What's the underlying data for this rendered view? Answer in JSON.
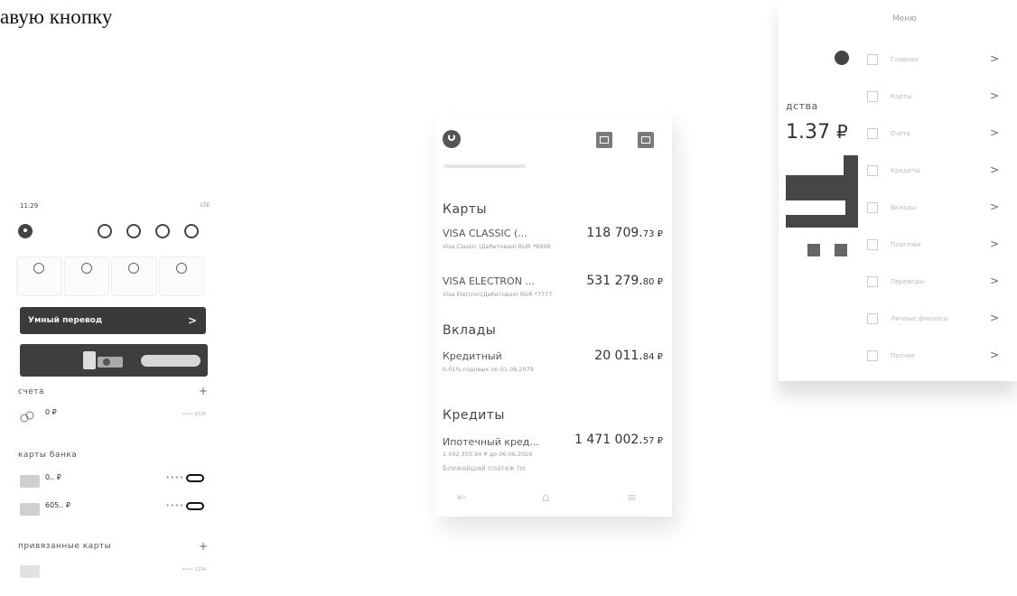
{
  "heading_fragment": "авую кнопку",
  "phone1": {
    "time": "11:29",
    "signal": "LTE",
    "quick_tiles": [
      {
        "icon": "transfer-icon",
        "label": ""
      },
      {
        "icon": "card-icon",
        "label": ""
      },
      {
        "icon": "phone-icon",
        "label": ""
      },
      {
        "icon": "smile-icon",
        "label": ""
      }
    ],
    "smart_transfer": "Умный перевод",
    "chevron": ">",
    "banner_text": "",
    "accounts": {
      "title": "счета",
      "plus": "+",
      "rows": [
        {
          "amount": "0 ₽",
          "sub": "",
          "number": "•••• 4315"
        }
      ]
    },
    "bank_cards": {
      "title": "карты банка",
      "rows": [
        {
          "amount": "0.. ₽",
          "sub": "",
          "dots": "••••"
        },
        {
          "amount": "605.. ₽",
          "sub": "",
          "dots": "••••"
        }
      ]
    },
    "linked_cards": {
      "title": "привязанные карты",
      "plus": "+",
      "rows": [
        {
          "amount": "",
          "sub": "",
          "number": "•••• 1154"
        }
      ]
    }
  },
  "phone2": {
    "cards": {
      "title": "Карты",
      "items": [
        {
          "name": "VISA CLASSIC (...",
          "amount_main": "118 709.",
          "amount_cents": "73 ₽",
          "detail1": "Visa Classic (Дебетовая) RUR *9999",
          "detail2": ""
        },
        {
          "name": "VISA ELECTRON ...",
          "amount_main": "531 279.",
          "amount_cents": "80 ₽",
          "detail1": "Visa Electron(Дебетовая) RUR *7777",
          "detail2": ""
        }
      ]
    },
    "deposits": {
      "title": "Вклады",
      "items": [
        {
          "name": "Кредитный",
          "amount_main": "20 011.",
          "amount_cents": "84 ₽",
          "detail1": "0.01% годовых по 01.06.2079",
          "detail2": ""
        }
      ]
    },
    "credits": {
      "title": "Кредиты",
      "items": [
        {
          "name": "Ипотечный кред...",
          "amount_main": "1 471 002.",
          "amount_cents": "57 ₽",
          "detail1": "1 042 355.94 ₽ до 06.06.2026",
          "detail2": "Ближайший платеж по"
        }
      ]
    },
    "nav": [
      "⇤",
      "⌂",
      "≡"
    ]
  },
  "phone3": {
    "menu_title": "Меню",
    "funds_label": "дства",
    "balance_main": "1.37",
    "balance_currency": "₽",
    "menu_items": [
      {
        "icon": "home-icon",
        "label": "Главная"
      },
      {
        "icon": "card-icon",
        "label": "Карты"
      },
      {
        "icon": "account-icon",
        "label": "Счета"
      },
      {
        "icon": "credit-icon",
        "label": "Кредиты"
      },
      {
        "icon": "deposit-icon",
        "label": "Вклады"
      },
      {
        "icon": "payment-icon",
        "label": "Платежи"
      },
      {
        "icon": "transfer-icon",
        "label": "Переводы"
      },
      {
        "icon": "template-icon",
        "label": "Личные финансы"
      },
      {
        "icon": "settings-icon",
        "label": "Прочее"
      }
    ],
    "chevron": ">"
  }
}
